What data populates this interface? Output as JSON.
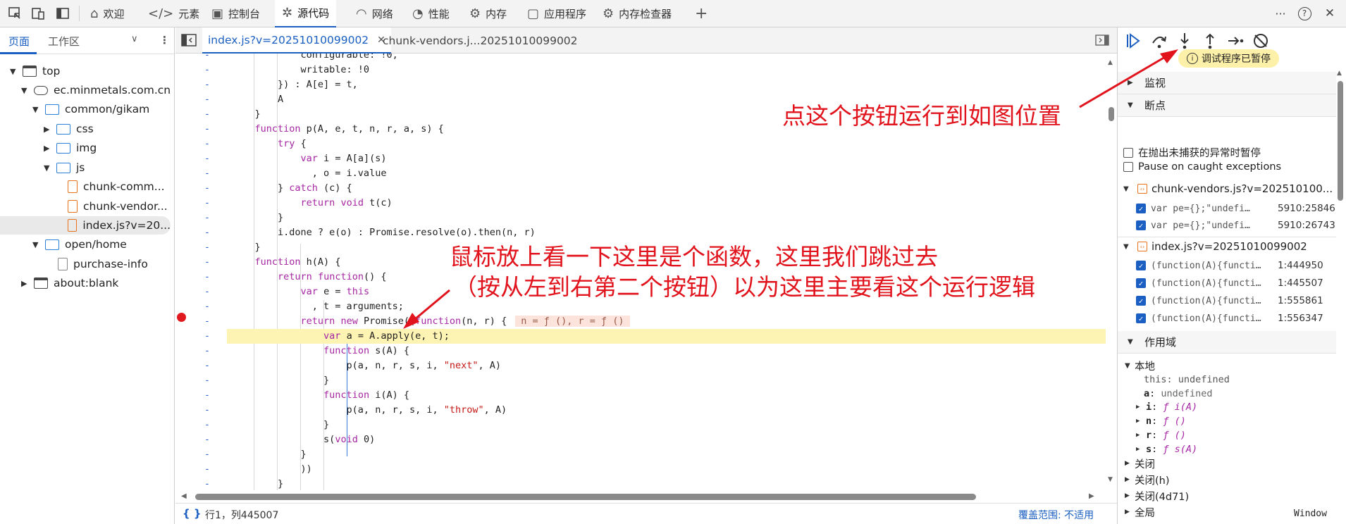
{
  "toolbar": {
    "tabs": [
      {
        "label": "欢迎",
        "icon": "home-icon"
      },
      {
        "label": "元素",
        "icon": "code-tag-icon"
      },
      {
        "label": "控制台",
        "icon": "console-icon"
      },
      {
        "label": "源代码",
        "icon": "bug-icon"
      },
      {
        "label": "网络",
        "icon": "wifi-icon"
      },
      {
        "label": "性能",
        "icon": "gauge-icon"
      },
      {
        "label": "内存",
        "icon": "chip-icon"
      },
      {
        "label": "应用程序",
        "icon": "app-window-icon"
      },
      {
        "label": "内存检查器",
        "icon": "gear-icon"
      }
    ],
    "plus": "+",
    "more": "···",
    "help": "?",
    "close": "✕"
  },
  "navigator": {
    "tabs": [
      "页面",
      "工作区"
    ],
    "tree": [
      {
        "label": "top",
        "type": "frame"
      },
      {
        "label": "ec.minmetals.com.cn",
        "type": "domain"
      },
      {
        "label": "common/gikam",
        "type": "folder"
      },
      {
        "label": "css",
        "type": "folder"
      },
      {
        "label": "img",
        "type": "folder"
      },
      {
        "label": "js",
        "type": "folder"
      },
      {
        "label": "chunk-comm...",
        "type": "file"
      },
      {
        "label": "chunk-vendor...",
        "type": "file"
      },
      {
        "label": "index.js?v=20...",
        "type": "file"
      },
      {
        "label": "open/home",
        "type": "folder"
      },
      {
        "label": "purchase-info",
        "type": "file"
      },
      {
        "label": "about:blank",
        "type": "frame"
      }
    ]
  },
  "editor": {
    "tabs": [
      "index.js?v=20251010099002",
      "chunk-vendors.j...20251010099002"
    ],
    "code_lines": [
      "            configurable: !0,",
      "            writable: !0",
      "        }) : A[e] = t,",
      "        A",
      "    }",
      "    function p(A, e, t, n, r, a, s) {",
      "        try {",
      "            var i = A[a](s)",
      "              , o = i.value",
      "        } catch (c) {",
      "            return void t(c)",
      "        }",
      "        i.done ? e(o) : Promise.resolve(o).then(n, r)",
      "    }",
      "    function h(A) {",
      "        return function() {",
      "            var e = this",
      "              , t = arguments;",
      "            return new Promise((function(n, r) {",
      "                var a = A.apply(e, t);",
      "                function s(A) {",
      "                    p(a, n, r, s, i, \"next\", A)",
      "                }",
      "                function i(A) {",
      "                    p(a, n, r, s, i, \"throw\", A)",
      "                }",
      "                s(void 0)",
      "            }",
      "            ))",
      "        }"
    ],
    "inline_hint": "n = ƒ (), r = ƒ ()",
    "gutter_mark": "-",
    "status_braces": "{ }",
    "status_position": "行1，列445007",
    "status_coverage": "覆盖范围: 不适用"
  },
  "debugger": {
    "paused_banner": "调试程序已暂停",
    "watch_label": "监视",
    "breakpoints_label": "断点",
    "pause_uncaught": "在抛出未捕获的异常时暂停",
    "pause_caught": "Pause on caught exceptions",
    "bp_groups": [
      {
        "file": "chunk-vendors.js?v=202510100...",
        "items": [
          {
            "code": "var pe={};\"undefi…",
            "loc": "5910:25846"
          },
          {
            "code": "var pe={};\"undefi…",
            "loc": "5910:26743"
          }
        ]
      },
      {
        "file": "index.js?v=20251010099002",
        "items": [
          {
            "code": "(function(A){functi…",
            "loc": "1:444950"
          },
          {
            "code": "(function(A){functi…",
            "loc": "1:445507"
          },
          {
            "code": "(function(A){functi…",
            "loc": "1:555861"
          },
          {
            "code": "(function(A){functi…",
            "loc": "1:556347"
          }
        ]
      }
    ],
    "scope_label": "作用域",
    "local_label": "本地",
    "scope_vars": [
      {
        "name": "this",
        "value": "undefined"
      },
      {
        "name": "a",
        "value": "undefined"
      },
      {
        "name": "i",
        "value": "ƒ i(A)"
      },
      {
        "name": "n",
        "value": "ƒ ()"
      },
      {
        "name": "r",
        "value": "ƒ ()"
      },
      {
        "name": "s",
        "value": "ƒ s(A)"
      }
    ],
    "closures": [
      "关闭",
      "关闭(h)",
      "关闭(4d71)",
      "全局"
    ],
    "global_value": "Window"
  },
  "annotations": {
    "top": "点这个按钮运行到如图位置",
    "middle_line1": "鼠标放上看一下这里是个函数，这里我们跳过去",
    "middle_line2": "（按从左到右第二个按钮）以为这里主要看这个运行逻辑"
  },
  "colors": {
    "accent": "#1a5fc1",
    "annotation": "#e1131c",
    "breakpoint": "#e0191f",
    "highlight": "#fdf3b3"
  }
}
